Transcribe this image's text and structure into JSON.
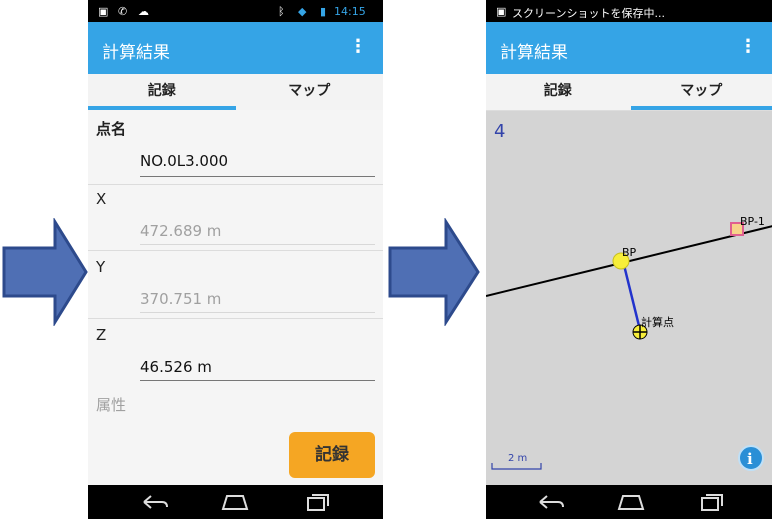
{
  "colors": {
    "arrow": "#4f6fb4",
    "appbar": "#35a4e6",
    "record_button": "#f5a623",
    "map_bg": "#d4d4d4",
    "link_line": "#2233cc",
    "point_fill": "#f7ee3a",
    "bp1_marker": "#e06090"
  },
  "screen1": {
    "status_time": "14:15",
    "title": "計算結果",
    "menu_icon": "⋮",
    "tabs": [
      "記録",
      "マップ"
    ],
    "fields": [
      {
        "label": "点名",
        "value": "NO.0L3.000"
      },
      {
        "label": "X",
        "value": "472.689 m"
      },
      {
        "label": "Y",
        "value": "370.751 m"
      },
      {
        "label": "Z",
        "value": "46.526 m"
      },
      {
        "label": "属性",
        "value": ""
      }
    ],
    "record_button": "記録"
  },
  "screen2": {
    "status_text": "スクリーンショットを保存中...",
    "title": "計算結果",
    "menu_icon": "⋮",
    "tabs": [
      "記録",
      "マップ"
    ],
    "map": {
      "north_glyph": "4",
      "labels": {
        "bp": "BP",
        "bp1": "BP-1",
        "calc": "計算点"
      },
      "scale_label": "2 m",
      "info_icon": "i"
    }
  }
}
